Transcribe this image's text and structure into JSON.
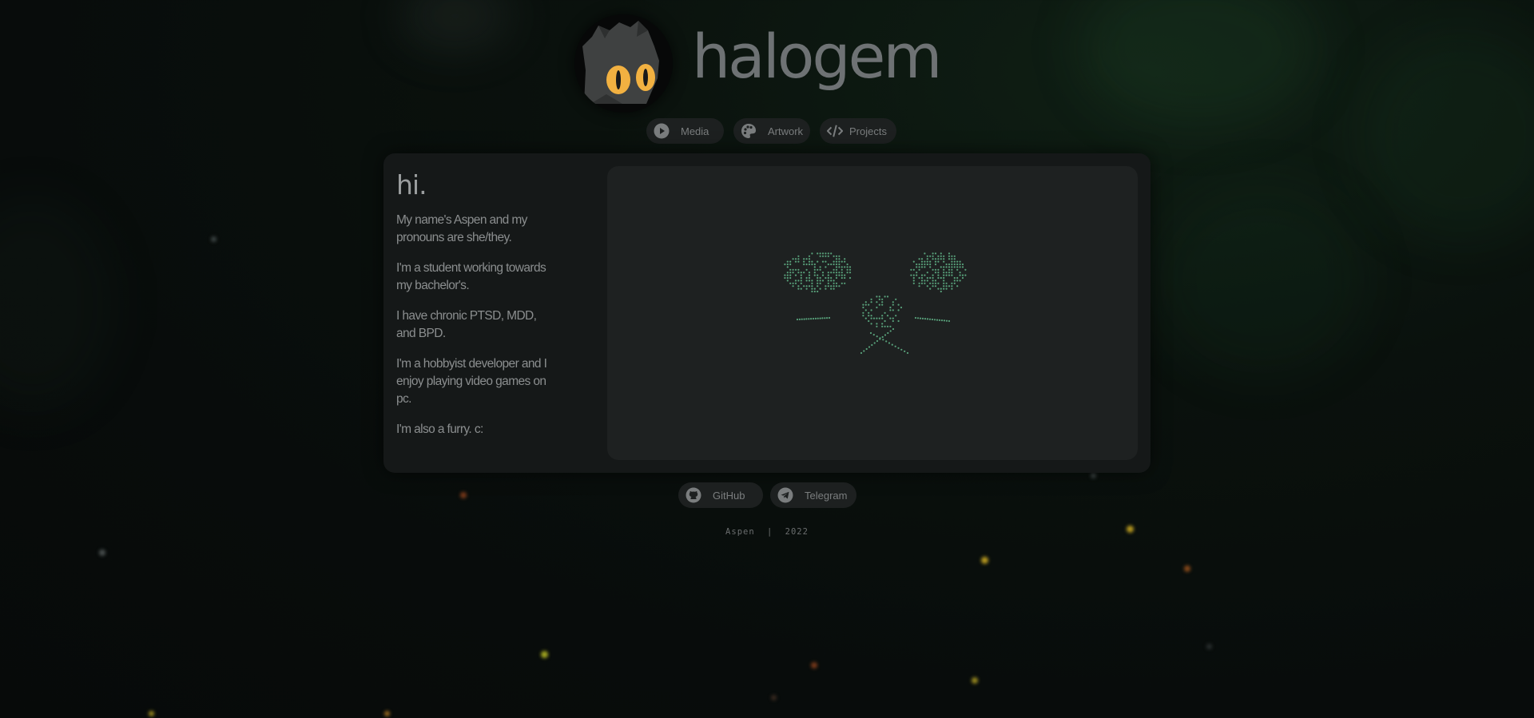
{
  "header": {
    "title": "halogem",
    "avatar_icon": "cat-avatar-icon"
  },
  "nav": {
    "items": [
      {
        "label": "Media",
        "icon": "play-icon"
      },
      {
        "label": "Artwork",
        "icon": "palette-icon"
      },
      {
        "label": "Projects",
        "icon": "code-icon"
      }
    ]
  },
  "intro": {
    "heading": "hi.",
    "paragraphs": [
      "My name's Aspen and my pronouns are she/they.",
      "I'm a student working towards my bachelor's.",
      "I have chronic PTSD, MDD, and BPD.",
      "I'm a hobbyist developer and I enjoy playing video games on pc.",
      "I'm also a furry. c:"
    ]
  },
  "art": {
    "ascii_color": "#58a07a",
    "description_icon": "crossed-flowers-ascii-art"
  },
  "socials": [
    {
      "label": "GitHub",
      "icon": "github-icon"
    },
    {
      "label": "Telegram",
      "icon": "telegram-icon"
    }
  ],
  "footer": {
    "author": "Aspen",
    "separator": "|",
    "year": "2022"
  },
  "colors": {
    "background": "#080c0b",
    "card": "#151818",
    "panel": "#1e2121",
    "pill": "#1d2020",
    "accent_eyes": "#f2b141"
  }
}
